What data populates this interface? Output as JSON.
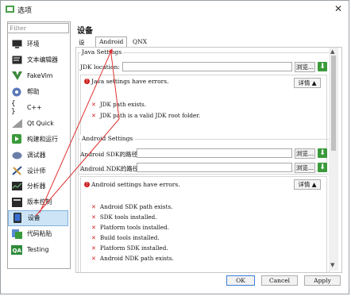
{
  "window": {
    "title": "选项",
    "close": "✕"
  },
  "sidebar": {
    "filter_placeholder": "Filter",
    "items": [
      {
        "label": "环境",
        "icon": "monitor-icon"
      },
      {
        "label": "文本编辑器",
        "icon": "text-editor-icon"
      },
      {
        "label": "FakeVim",
        "icon": "fakevim-icon"
      },
      {
        "label": "帮助",
        "icon": "help-icon"
      },
      {
        "label": "C++",
        "icon": "cpp-braces-icon"
      },
      {
        "label": "Qt Quick",
        "icon": "qtquick-icon"
      },
      {
        "label": "构建和运行",
        "icon": "build-run-icon"
      },
      {
        "label": "调试器",
        "icon": "debugger-icon"
      },
      {
        "label": "设计师",
        "icon": "designer-icon"
      },
      {
        "label": "分析器",
        "icon": "analyzer-icon"
      },
      {
        "label": "版本控制",
        "icon": "version-control-icon"
      },
      {
        "label": "设备",
        "icon": "device-icon"
      },
      {
        "label": "代码粘贴",
        "icon": "code-paste-icon"
      },
      {
        "label": "Testing",
        "icon": "qa-testing-icon"
      }
    ],
    "selected_index": 11
  },
  "page": {
    "heading": "设备",
    "tabs": [
      "设备",
      "Android",
      "QNX"
    ],
    "active_tab": "Android"
  },
  "java": {
    "group_title": "Java Settings",
    "jdk_label": "JDK location:",
    "jdk_value": "",
    "browse": "浏览...",
    "error_title": "Java settings have errors.",
    "details": "详情 ▲",
    "checks": [
      "JDK path exists.",
      "JDK path is a valid JDK root folder."
    ]
  },
  "android": {
    "group_title": "Android Settings",
    "sdk_label": "Android SDK的路径:",
    "ndk_label": "Android NDK的路径:",
    "sdk_value": "",
    "ndk_value": "",
    "browse": "浏览...",
    "error_title": "Android settings have errors.",
    "details": "详情 ▲",
    "checks": [
      "Android SDK path exists.",
      "SDK tools installed.",
      "Platform tools installed.",
      "Build tools installed.",
      "Platform SDK installed.",
      "Android NDK path exists."
    ]
  },
  "footer": {
    "ok": "OK",
    "cancel": "Cancel",
    "apply": "Apply"
  },
  "colors": {
    "error": "#d02020",
    "download": "#3a9a3a",
    "annotation": "#e03030",
    "selection": "#cde4f7"
  }
}
